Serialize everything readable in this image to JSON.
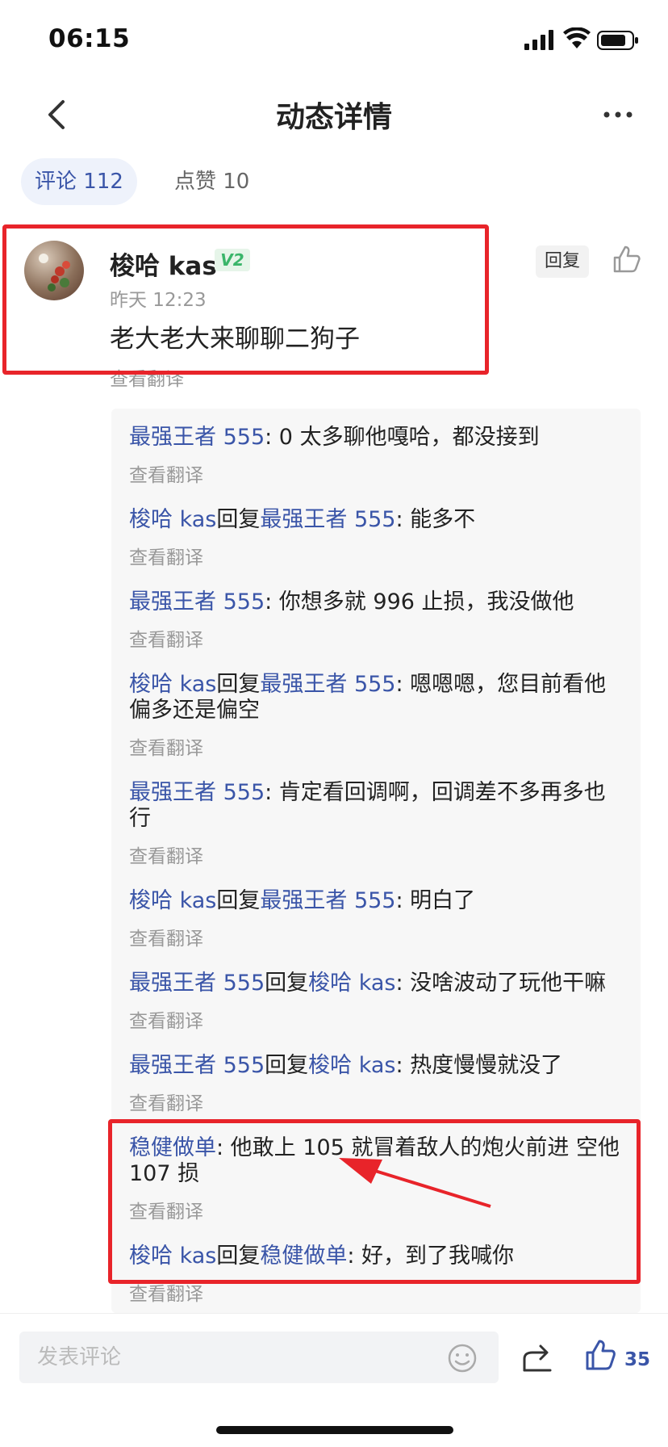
{
  "status": {
    "time": "06:15"
  },
  "nav": {
    "title": "动态详情"
  },
  "tabs": [
    {
      "label": "评论 112",
      "active": true
    },
    {
      "label": "点赞 10",
      "active": false
    }
  ],
  "main_comment": {
    "username": "梭哈 kas",
    "badge": "V2",
    "time": "昨天 12:23",
    "text": "老大老大来聊聊二狗子",
    "translate": "查看翻译",
    "reply_label": "回复"
  },
  "replies": [
    {
      "from": "最强王者 555",
      "reply_word": "",
      "to": "",
      "text": ": 0 太多聊他嘎哈，都没接到",
      "translate": "查看翻译"
    },
    {
      "from": "梭哈 kas",
      "reply_word": "回复",
      "to": "最强王者 555",
      "text": ": 能多不",
      "translate": "查看翻译"
    },
    {
      "from": "最强王者 555",
      "reply_word": "",
      "to": "",
      "text": ": 你想多就 996 止损，我没做他",
      "translate": "查看翻译"
    },
    {
      "from": "梭哈 kas",
      "reply_word": "回复",
      "to": "最强王者 555",
      "text": ": 嗯嗯嗯，您目前看他偏多还是偏空",
      "translate": "查看翻译"
    },
    {
      "from": "最强王者 555",
      "reply_word": "",
      "to": "",
      "text": ": 肯定看回调啊，回调差不多再多也行",
      "translate": "查看翻译"
    },
    {
      "from": "梭哈 kas",
      "reply_word": "回复",
      "to": "最强王者 555",
      "text": ": 明白了",
      "translate": "查看翻译"
    },
    {
      "from": "最强王者 555",
      "reply_word": "回复",
      "to": "梭哈 kas",
      "text": ": 没啥波动了玩他干嘛",
      "translate": "查看翻译"
    },
    {
      "from": "最强王者 555",
      "reply_word": "回复",
      "to": "梭哈 kas",
      "text": ": 热度慢慢就没了",
      "translate": "查看翻译"
    },
    {
      "from": "稳健做单",
      "reply_word": "",
      "to": "",
      "text": ": 他敢上 105 就冒着敌人的炮火前进 空他 107 损",
      "translate": "查看翻译"
    },
    {
      "from": "梭哈 kas",
      "reply_word": "回复",
      "to": "稳健做单",
      "text": ": 好，到了我喊你",
      "translate": "查看翻译"
    }
  ],
  "bottom": {
    "input_placeholder": "发表评论",
    "like_count": "35"
  },
  "colors": {
    "accent": "#3a55a8",
    "highlight": "#e8242a",
    "badge_green": "#3bb56a"
  }
}
